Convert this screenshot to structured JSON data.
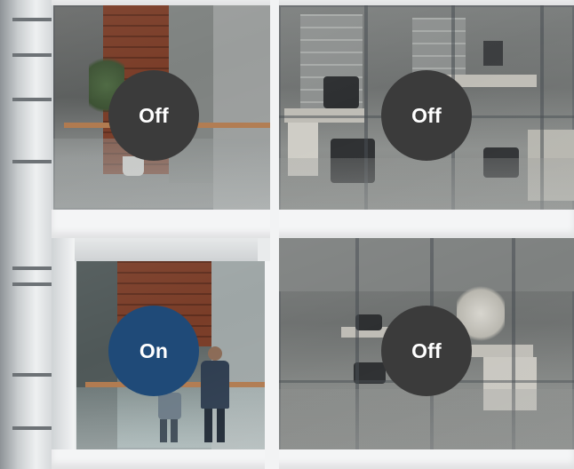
{
  "colors": {
    "off_badge": "#3b3b3b",
    "on_badge": "#1f4a78",
    "badge_text": "#ffffff",
    "frame": "#f2f3f4"
  },
  "rooms": [
    {
      "id": "upper-left",
      "toggle_label": "Off",
      "state": "off"
    },
    {
      "id": "upper-right",
      "toggle_label": "Off",
      "state": "off"
    },
    {
      "id": "lower-left",
      "toggle_label": "On",
      "state": "on"
    },
    {
      "id": "lower-right",
      "toggle_label": "Off",
      "state": "off"
    }
  ]
}
